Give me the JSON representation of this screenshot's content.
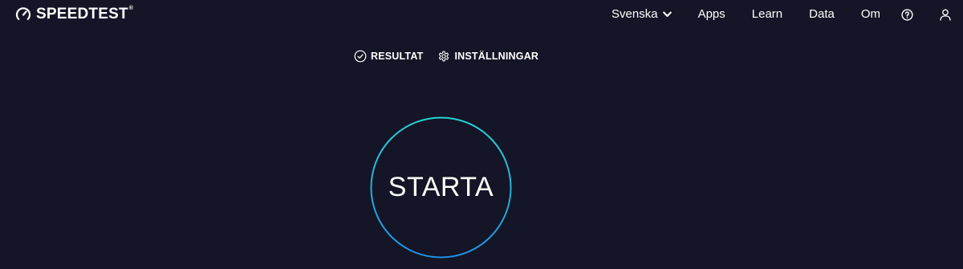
{
  "header": {
    "logo_text": "SPEEDTEST",
    "logo_tm": "®",
    "logo_icon": "speedometer-icon",
    "nav": {
      "language": "Svenska",
      "apps": "Apps",
      "learn": "Learn",
      "data": "Data",
      "about": "Om",
      "help_icon": "question-circle-icon",
      "user_icon": "user-icon"
    }
  },
  "subnav": {
    "results_label": "RESULTAT",
    "results_icon": "check-circle-icon",
    "settings_label": "INSTÄLLNINGAR",
    "settings_icon": "gear-icon"
  },
  "start": {
    "label": "STARTA"
  },
  "colors": {
    "background": "#141526",
    "text": "#ffffff",
    "ring_cyan": "#26d4d4",
    "ring_blue": "#1f8fe0"
  }
}
